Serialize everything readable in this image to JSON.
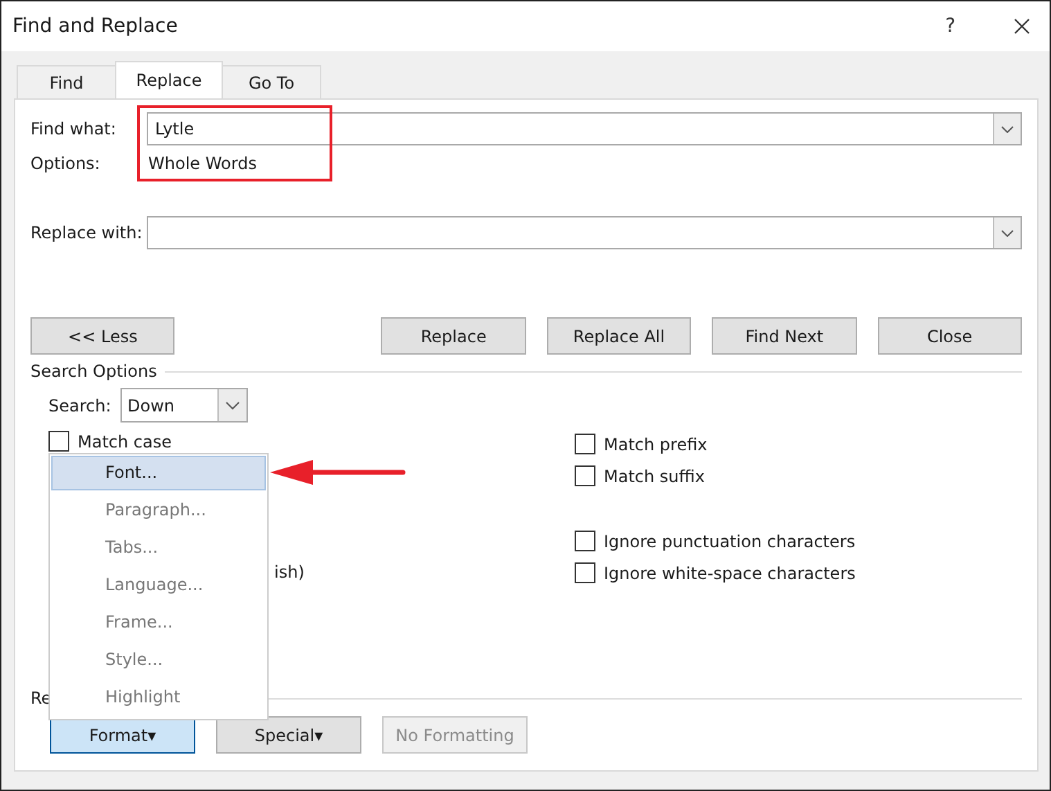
{
  "window": {
    "title": "Find and Replace",
    "help": "?"
  },
  "tabs": [
    {
      "label": "Find",
      "selected": false
    },
    {
      "label": "Replace",
      "selected": true
    },
    {
      "label": "Go To",
      "selected": false
    }
  ],
  "find_what": {
    "label": "Find what:",
    "value": "Lytle"
  },
  "options": {
    "label": "Options:",
    "value": "Whole Words"
  },
  "replace_with": {
    "label": "Replace with:"
  },
  "buttons": [
    {
      "label": "<< Less",
      "kind": "toggle"
    },
    {
      "label": "Replace",
      "kind": "action"
    },
    {
      "label": "Replace All",
      "kind": "action"
    },
    {
      "label": "Find Next",
      "kind": "action"
    },
    {
      "label": "Close",
      "kind": "action"
    }
  ],
  "search_options": {
    "title": "Search Options",
    "search_label": "Search:",
    "search_value": "Down"
  },
  "left_checks": [
    {
      "label": "Match case",
      "checked": false
    }
  ],
  "left_fragment": {
    "label": "ish)"
  },
  "right_check_groups": [
    [
      {
        "label": "Match prefix",
        "checked": false
      },
      {
        "label": "Match suffix",
        "checked": false
      }
    ],
    [
      {
        "label": "Ignore punctuation characters",
        "checked": false
      },
      {
        "label": "Ignore white-space characters",
        "checked": false
      }
    ]
  ],
  "replace_section": {
    "label": "Re"
  },
  "bottom_buttons": [
    {
      "label": "Format",
      "caret": "▾",
      "pressed": true,
      "disabled": false
    },
    {
      "label": "Special",
      "caret": "▾",
      "pressed": false,
      "disabled": false
    },
    {
      "label": "No Formatting",
      "pressed": false,
      "disabled": true
    }
  ],
  "format_menu": [
    {
      "label": "Font...",
      "selected": true
    },
    {
      "label": "Paragraph...",
      "selected": false
    },
    {
      "label": "Tabs...",
      "selected": false
    },
    {
      "label": "Language...",
      "selected": false
    },
    {
      "label": "Frame...",
      "selected": false
    },
    {
      "label": "Style...",
      "selected": false
    },
    {
      "label": "Highlight",
      "selected": false
    }
  ]
}
